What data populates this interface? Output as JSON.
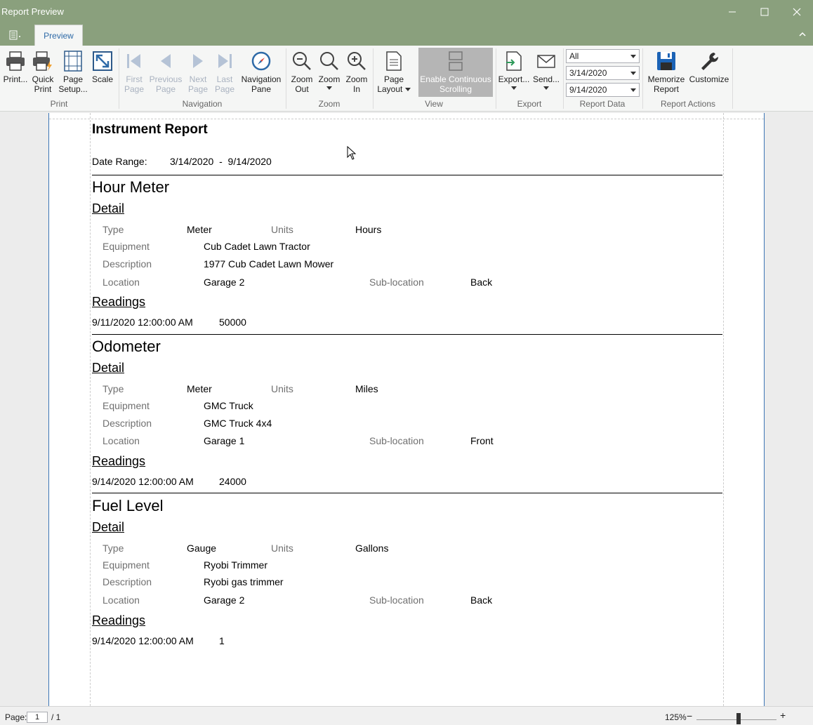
{
  "window": {
    "title": "Report Preview"
  },
  "ribbon": {
    "tab": "Preview",
    "buttons": {
      "print": "Print...",
      "quick_print": "Quick\nPrint",
      "page_setup": "Page\nSetup...",
      "scale": "Scale",
      "first_page": "First\nPage",
      "previous_page": "Previous\nPage",
      "next_page": "Next\nPage",
      "last_page": "Last\nPage",
      "navigation_pane": "Navigation\nPane",
      "zoom_out": "Zoom\nOut",
      "zoom": "Zoom",
      "zoom_in": "Zoom\nIn",
      "page_layout": "Page\nLayout",
      "continuous_scrolling": "Enable Continuous\nScrolling",
      "export": "Export...",
      "send": "Send...",
      "memorize_report": "Memorize\nReport",
      "customize": "Customize"
    },
    "groups": {
      "print": "Print",
      "navigation": "Navigation",
      "zoom": "Zoom",
      "view": "View",
      "export": "Export",
      "report_data": "Report Data",
      "report_actions": "Report Actions"
    },
    "report_data": {
      "filter": "All",
      "start_date": "3/14/2020",
      "end_date": "9/14/2020"
    }
  },
  "report": {
    "title": "Instrument Report",
    "date_range_label": "Date Range:",
    "date_from": "3/14/2020",
    "date_sep": "-",
    "date_to": "9/14/2020",
    "labels": {
      "detail": "Detail",
      "readings": "Readings",
      "type": "Type",
      "units": "Units",
      "equipment": "Equipment",
      "description": "Description",
      "location": "Location",
      "sublocation": "Sub-location"
    },
    "sections": [
      {
        "name": "Hour Meter",
        "type": "Meter",
        "units": "Hours",
        "equipment": "Cub Cadet Lawn Tractor",
        "description": "1977 Cub Cadet Lawn Mower",
        "location": "Garage 2",
        "sublocation": "Back",
        "reading_date": "9/11/2020 12:00:00 AM",
        "reading_value": "50000"
      },
      {
        "name": "Odometer",
        "type": "Meter",
        "units": "Miles",
        "equipment": "GMC Truck",
        "description": "GMC Truck 4x4",
        "location": "Garage 1",
        "sublocation": "Front",
        "reading_date": "9/14/2020 12:00:00 AM",
        "reading_value": "24000"
      },
      {
        "name": "Fuel Level",
        "type": "Gauge",
        "units": "Gallons",
        "equipment": "Ryobi Trimmer",
        "description": "Ryobi gas trimmer",
        "location": "Garage 2",
        "sublocation": "Back",
        "reading_date": "9/14/2020 12:00:00 AM",
        "reading_value": "1"
      }
    ]
  },
  "status": {
    "page_label": "Page:",
    "page_current": "1",
    "page_total": "/ 1",
    "zoom": "125%",
    "zoom_minus": "−",
    "zoom_plus": "+"
  },
  "colors": {
    "titlebar": "#8aa07d",
    "accent": "#2e6aa7",
    "page_border": "#3c76b5"
  }
}
